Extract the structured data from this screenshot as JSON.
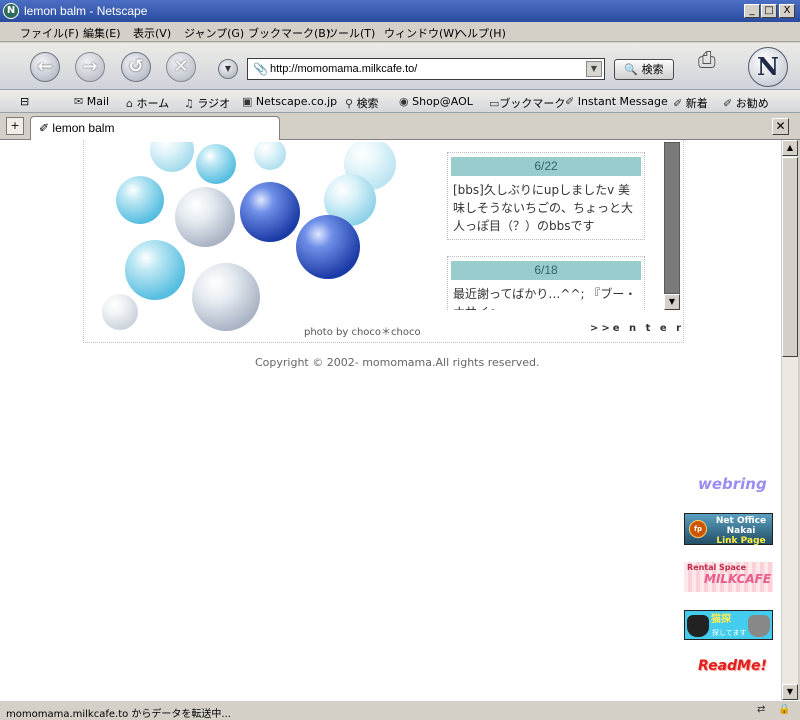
{
  "window": {
    "title": "lemon  balm - Netscape",
    "controls": [
      "_",
      "□",
      "X"
    ]
  },
  "menu": [
    "ファイル(F)",
    "編集(E)",
    "表示(V)",
    "ジャンプ(G)",
    "ブックマーク(B)",
    "ツール(T)",
    "ウィンドウ(W)",
    "ヘルプ(H)"
  ],
  "navbar": {
    "url": "http://momomama.milkcafe.to/",
    "search_label": "検索"
  },
  "personal_toolbar": [
    "Mail",
    "ホーム",
    "ラジオ",
    "Netscape.co.jp",
    "検索",
    "Shop@AOL",
    "ブックマーク",
    "Instant Message",
    "新着",
    "お勧め"
  ],
  "tab": {
    "label": "lemon  balm"
  },
  "page": {
    "photo_caption": "photo by choco＊choco",
    "enter_label": ">>e n t e r",
    "news": [
      {
        "date": "6/22",
        "text": "[bbs]久しぶりにupしましたv 美味しそうないちごの、ちょっと大人っぽ目（？）のbbsです"
      },
      {
        "date": "6/18",
        "text": "最近謝ってばかり…^^; 『ブー・ナサイ』…"
      }
    ],
    "copyright": "Copyright © 2002- momomama.All rights reserved."
  },
  "banners": {
    "webring": "webring",
    "nakai_line1": "Net Office",
    "nakai_line2": "Nakai",
    "nakai_line3": "Link Page",
    "milkcafe_line1": "Rental Space",
    "milkcafe_line2": "MILKCAFE",
    "neko_line1": "猫探",
    "neko_line2": "探してます",
    "readme": "ReadMe!"
  },
  "status": {
    "text": "momomama.milkcafe.to からデータを転送中..."
  },
  "colors": {
    "news_date_bg": "#99cccc",
    "title_bar": "#2a4c9f"
  }
}
